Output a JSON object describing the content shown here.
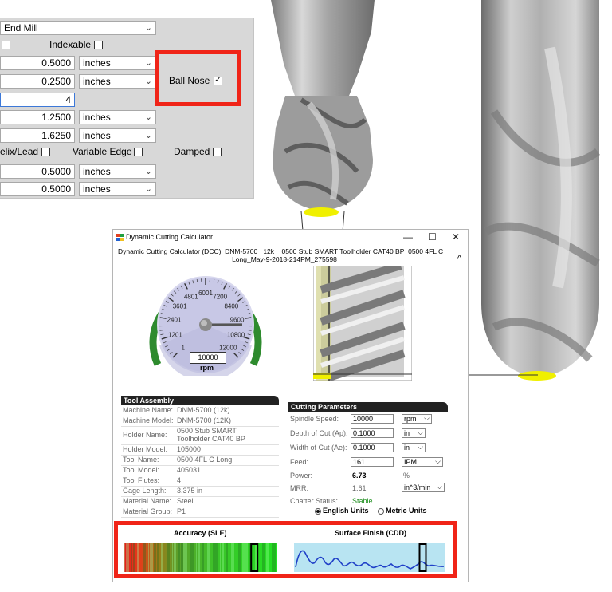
{
  "tool_form": {
    "tool_type": "End Mill",
    "indexable_label": "Indexable",
    "ball_nose_label": "Ball Nose",
    "row1_value": "0.5000",
    "row1_unit": "inches",
    "row2_value": "0.2500",
    "row2_unit": "inches",
    "row3_value": "4",
    "row4_value": "1.2500",
    "row4_unit": "inches",
    "row5_value": "1.6250",
    "row5_unit": "inches",
    "helix_lead_label": "elix/Lead",
    "variable_edge_label": "Variable Edge",
    "damped_label": "Damped",
    "row6_value": "0.5000",
    "row6_unit": "inches",
    "row7_value": "0.5000",
    "row7_unit": "inches"
  },
  "dcc_window": {
    "title": "Dynamic Cutting Calculator",
    "header_line1": "Dynamic Cutting Calculator (DCC): DNM-5700 _12k__0500 Stub SMART Toolholder CAT40 BP_0500 4FL C",
    "header_line2": "Long_May-9-2018-214PM_275598",
    "gauge": {
      "ticks": [
        "1",
        "1201",
        "2401",
        "3601",
        "4801",
        "6001",
        "7200",
        "8400",
        "9600",
        "10800",
        "12000"
      ],
      "rpm_value": "10000",
      "rpm_label": "rpm",
      "level": 0.833
    },
    "tool_assembly": {
      "title": "Tool Assembly",
      "rows": [
        {
          "label": "Machine Name:",
          "value": "DNM-5700 (12k)"
        },
        {
          "label": "Machine Model:",
          "value": "DNM-5700 (12K)"
        },
        {
          "label": "Holder Name:",
          "value": "0500 Stub SMART Toolholder CAT40 BP"
        },
        {
          "label": "Holder Model:",
          "value": "105000"
        },
        {
          "label": "Tool Name:",
          "value": "0500 4FL C Long"
        },
        {
          "label": "Tool Model:",
          "value": "405031"
        },
        {
          "label": "Tool Flutes:",
          "value": "4"
        },
        {
          "label": "Gage Length:",
          "value": "3.375 in"
        },
        {
          "label": "Material Name:",
          "value": "Steel"
        },
        {
          "label": "Material Group:",
          "value": "P1"
        }
      ]
    },
    "cutting_parameters": {
      "title": "Cutting Parameters",
      "spindle_speed_label": "Spindle Speed:",
      "spindle_speed_value": "10000",
      "spindle_speed_unit": "rpm",
      "doc_label": "Depth of Cut (Ap):",
      "doc_value": "0.1000",
      "doc_unit": "in",
      "woc_label": "Width of Cut (Ae):",
      "woc_value": "0.1000",
      "woc_unit": "in",
      "feed_label": "Feed:",
      "feed_value": "161",
      "feed_unit": "IPM",
      "power_label": "Power:",
      "power_value": "6.73",
      "power_unit": "%",
      "mrr_label": "MRR:",
      "mrr_value": "1.61",
      "mrr_unit": "in^3/min",
      "chatter_label": "Chatter Status:",
      "chatter_value": "Stable",
      "english_units": "English Units",
      "metric_units": "Metric Units"
    },
    "accuracy_label": "Accuracy (SLE)",
    "surface_finish_label": "Surface Finish (CDD)",
    "accuracy_marker": 0.85,
    "finish_marker": 0.85
  },
  "colors": {
    "highlight_red": "#f02418",
    "gauge_green": "#2e8b2e",
    "gauge_face": "#c8c8e6",
    "chatter_stable": "#1a8c1a",
    "tool_contact_yellow": "#f0f000"
  }
}
